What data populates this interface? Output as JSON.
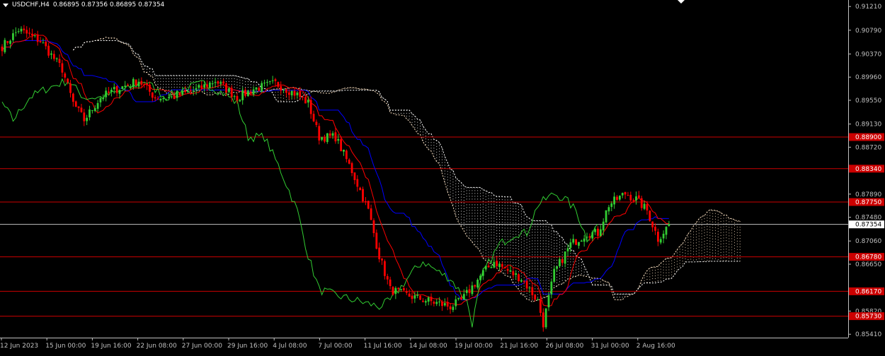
{
  "header": {
    "symbol": "USDCHF,H4",
    "ohlc": "0.86895 0.87356 0.86895 0.87354"
  },
  "colors": {
    "background": "#000000",
    "axis": "#c0c0c0",
    "bull": "#32cd32",
    "bear": "#ff0000",
    "tenkan": "#ff0000",
    "kijun": "#0000ff",
    "chikou": "#32cd32",
    "kumo_a": "#ffe4c4",
    "kumo_b": "#ffffff",
    "level_line": "#cc0000",
    "current_price_line": "#c0c0c0"
  },
  "chart_data": {
    "type": "candlestick",
    "indicator": "Ichimoku Kinko Hyo",
    "y_range": [
      0.8535,
      0.913
    ],
    "y_ticks": [
      "0.91210",
      "0.90790",
      "0.90370",
      "0.89960",
      "0.89550",
      "0.89130",
      "0.88720",
      "0.87890",
      "0.87480",
      "0.87060",
      "0.86650",
      "0.85820",
      "0.85410"
    ],
    "x_ticks": [
      "12 Jun 2023",
      "15 Jun 00:00",
      "19 Jun 16:00",
      "22 Jun 08:00",
      "27 Jun 00:00",
      "29 Jun 16:00",
      "4 Jul 08:00",
      "7 Jul 00:00",
      "11 Jul 16:00",
      "14 Jul 08:00",
      "19 Jul 00:00",
      "21 Jul 16:00",
      "26 Jul 08:00",
      "31 Jul 00:00",
      "2 Aug 16:00"
    ],
    "horizontal_levels": [
      "0.88900",
      "0.88340",
      "0.87750",
      "0.86780",
      "0.86170",
      "0.85730"
    ],
    "current_price": "0.87354",
    "anchors": [
      [
        0,
        0.905
      ],
      [
        6,
        0.908
      ],
      [
        14,
        0.906
      ],
      [
        22,
        0.901
      ],
      [
        26,
        0.895
      ],
      [
        30,
        0.892
      ],
      [
        36,
        0.896
      ],
      [
        42,
        0.8975
      ],
      [
        50,
        0.899
      ],
      [
        56,
        0.896
      ],
      [
        62,
        0.896
      ],
      [
        72,
        0.8975
      ],
      [
        78,
        0.899
      ],
      [
        86,
        0.896
      ],
      [
        92,
        0.8975
      ],
      [
        100,
        0.8985
      ],
      [
        108,
        0.8965
      ],
      [
        112,
        0.895
      ],
      [
        116,
        0.889
      ],
      [
        122,
        0.889
      ],
      [
        128,
        0.883
      ],
      [
        134,
        0.876
      ],
      [
        138,
        0.868
      ],
      [
        142,
        0.862
      ],
      [
        148,
        0.861
      ],
      [
        156,
        0.86
      ],
      [
        164,
        0.859
      ],
      [
        168,
        0.86
      ],
      [
        172,
        0.8625
      ],
      [
        176,
        0.865
      ],
      [
        180,
        0.867
      ],
      [
        186,
        0.865
      ],
      [
        190,
        0.864
      ],
      [
        196,
        0.86
      ],
      [
        198,
        0.856
      ],
      [
        202,
        0.865
      ],
      [
        208,
        0.87
      ],
      [
        214,
        0.872
      ],
      [
        218,
        0.872
      ],
      [
        222,
        0.877
      ],
      [
        228,
        0.879
      ],
      [
        232,
        0.878
      ],
      [
        236,
        0.876
      ],
      [
        240,
        0.871
      ],
      [
        244,
        0.8735
      ]
    ],
    "bar_count": 245
  }
}
